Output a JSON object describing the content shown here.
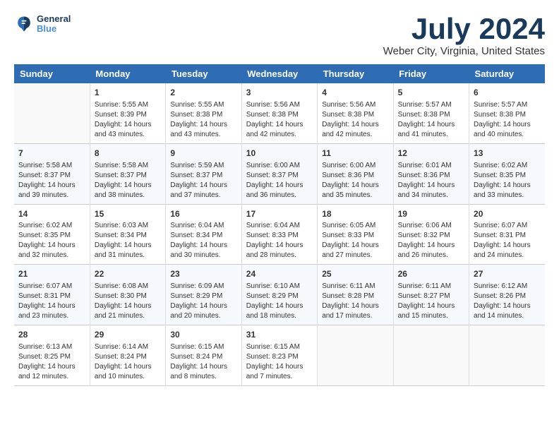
{
  "header": {
    "logo_line1": "General",
    "logo_line2": "Blue",
    "month": "July 2024",
    "location": "Weber City, Virginia, United States"
  },
  "weekdays": [
    "Sunday",
    "Monday",
    "Tuesday",
    "Wednesday",
    "Thursday",
    "Friday",
    "Saturday"
  ],
  "weeks": [
    [
      {
        "day": "",
        "text": ""
      },
      {
        "day": "1",
        "text": "Sunrise: 5:55 AM\nSunset: 8:39 PM\nDaylight: 14 hours\nand 43 minutes."
      },
      {
        "day": "2",
        "text": "Sunrise: 5:55 AM\nSunset: 8:38 PM\nDaylight: 14 hours\nand 43 minutes."
      },
      {
        "day": "3",
        "text": "Sunrise: 5:56 AM\nSunset: 8:38 PM\nDaylight: 14 hours\nand 42 minutes."
      },
      {
        "day": "4",
        "text": "Sunrise: 5:56 AM\nSunset: 8:38 PM\nDaylight: 14 hours\nand 42 minutes."
      },
      {
        "day": "5",
        "text": "Sunrise: 5:57 AM\nSunset: 8:38 PM\nDaylight: 14 hours\nand 41 minutes."
      },
      {
        "day": "6",
        "text": "Sunrise: 5:57 AM\nSunset: 8:38 PM\nDaylight: 14 hours\nand 40 minutes."
      }
    ],
    [
      {
        "day": "7",
        "text": "Sunrise: 5:58 AM\nSunset: 8:37 PM\nDaylight: 14 hours\nand 39 minutes."
      },
      {
        "day": "8",
        "text": "Sunrise: 5:58 AM\nSunset: 8:37 PM\nDaylight: 14 hours\nand 38 minutes."
      },
      {
        "day": "9",
        "text": "Sunrise: 5:59 AM\nSunset: 8:37 PM\nDaylight: 14 hours\nand 37 minutes."
      },
      {
        "day": "10",
        "text": "Sunrise: 6:00 AM\nSunset: 8:37 PM\nDaylight: 14 hours\nand 36 minutes."
      },
      {
        "day": "11",
        "text": "Sunrise: 6:00 AM\nSunset: 8:36 PM\nDaylight: 14 hours\nand 35 minutes."
      },
      {
        "day": "12",
        "text": "Sunrise: 6:01 AM\nSunset: 8:36 PM\nDaylight: 14 hours\nand 34 minutes."
      },
      {
        "day": "13",
        "text": "Sunrise: 6:02 AM\nSunset: 8:35 PM\nDaylight: 14 hours\nand 33 minutes."
      }
    ],
    [
      {
        "day": "14",
        "text": "Sunrise: 6:02 AM\nSunset: 8:35 PM\nDaylight: 14 hours\nand 32 minutes."
      },
      {
        "day": "15",
        "text": "Sunrise: 6:03 AM\nSunset: 8:34 PM\nDaylight: 14 hours\nand 31 minutes."
      },
      {
        "day": "16",
        "text": "Sunrise: 6:04 AM\nSunset: 8:34 PM\nDaylight: 14 hours\nand 30 minutes."
      },
      {
        "day": "17",
        "text": "Sunrise: 6:04 AM\nSunset: 8:33 PM\nDaylight: 14 hours\nand 28 minutes."
      },
      {
        "day": "18",
        "text": "Sunrise: 6:05 AM\nSunset: 8:33 PM\nDaylight: 14 hours\nand 27 minutes."
      },
      {
        "day": "19",
        "text": "Sunrise: 6:06 AM\nSunset: 8:32 PM\nDaylight: 14 hours\nand 26 minutes."
      },
      {
        "day": "20",
        "text": "Sunrise: 6:07 AM\nSunset: 8:31 PM\nDaylight: 14 hours\nand 24 minutes."
      }
    ],
    [
      {
        "day": "21",
        "text": "Sunrise: 6:07 AM\nSunset: 8:31 PM\nDaylight: 14 hours\nand 23 minutes."
      },
      {
        "day": "22",
        "text": "Sunrise: 6:08 AM\nSunset: 8:30 PM\nDaylight: 14 hours\nand 21 minutes."
      },
      {
        "day": "23",
        "text": "Sunrise: 6:09 AM\nSunset: 8:29 PM\nDaylight: 14 hours\nand 20 minutes."
      },
      {
        "day": "24",
        "text": "Sunrise: 6:10 AM\nSunset: 8:29 PM\nDaylight: 14 hours\nand 18 minutes."
      },
      {
        "day": "25",
        "text": "Sunrise: 6:11 AM\nSunset: 8:28 PM\nDaylight: 14 hours\nand 17 minutes."
      },
      {
        "day": "26",
        "text": "Sunrise: 6:11 AM\nSunset: 8:27 PM\nDaylight: 14 hours\nand 15 minutes."
      },
      {
        "day": "27",
        "text": "Sunrise: 6:12 AM\nSunset: 8:26 PM\nDaylight: 14 hours\nand 14 minutes."
      }
    ],
    [
      {
        "day": "28",
        "text": "Sunrise: 6:13 AM\nSunset: 8:25 PM\nDaylight: 14 hours\nand 12 minutes."
      },
      {
        "day": "29",
        "text": "Sunrise: 6:14 AM\nSunset: 8:24 PM\nDaylight: 14 hours\nand 10 minutes."
      },
      {
        "day": "30",
        "text": "Sunrise: 6:15 AM\nSunset: 8:24 PM\nDaylight: 14 hours\nand 8 minutes."
      },
      {
        "day": "31",
        "text": "Sunrise: 6:15 AM\nSunset: 8:23 PM\nDaylight: 14 hours\nand 7 minutes."
      },
      {
        "day": "",
        "text": ""
      },
      {
        "day": "",
        "text": ""
      },
      {
        "day": "",
        "text": ""
      }
    ]
  ]
}
